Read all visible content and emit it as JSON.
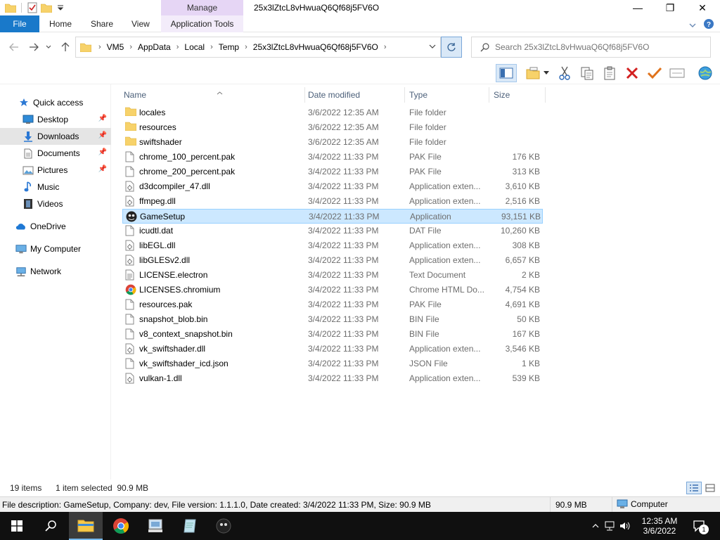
{
  "titlebar": {
    "manage_label": "Manage",
    "window_title": "25x3lZtcL8vHwuaQ6Qf68j5FV6O",
    "minimize": "—",
    "maximize": "❐",
    "close": "✕"
  },
  "ribbon": {
    "file": "File",
    "home": "Home",
    "share": "Share",
    "view": "View",
    "app_tools": "Application Tools"
  },
  "address": {
    "crumbs": [
      "VM5",
      "AppData",
      "Local",
      "Temp",
      "25x3lZtcL8vHwuaQ6Qf68j5FV6O"
    ]
  },
  "search": {
    "placeholder": "Search 25x3lZtcL8vHwuaQ6Qf68j5FV6O"
  },
  "navpane": {
    "quick_access": "Quick access",
    "desktop": "Desktop",
    "downloads": "Downloads",
    "documents": "Documents",
    "pictures": "Pictures",
    "music": "Music",
    "videos": "Videos",
    "onedrive": "OneDrive",
    "my_computer": "My Computer",
    "network": "Network"
  },
  "columns": {
    "name": "Name",
    "date": "Date modified",
    "type": "Type",
    "size": "Size"
  },
  "files": [
    {
      "name": "locales",
      "date": "3/6/2022 12:35 AM",
      "type": "File folder",
      "size": "",
      "icon": "folder"
    },
    {
      "name": "resources",
      "date": "3/6/2022 12:35 AM",
      "type": "File folder",
      "size": "",
      "icon": "folder"
    },
    {
      "name": "swiftshader",
      "date": "3/6/2022 12:35 AM",
      "type": "File folder",
      "size": "",
      "icon": "folder"
    },
    {
      "name": "chrome_100_percent.pak",
      "date": "3/4/2022 11:33 PM",
      "type": "PAK File",
      "size": "176 KB",
      "icon": "file"
    },
    {
      "name": "chrome_200_percent.pak",
      "date": "3/4/2022 11:33 PM",
      "type": "PAK File",
      "size": "313 KB",
      "icon": "file"
    },
    {
      "name": "d3dcompiler_47.dll",
      "date": "3/4/2022 11:33 PM",
      "type": "Application exten...",
      "size": "3,610 KB",
      "icon": "dll"
    },
    {
      "name": "ffmpeg.dll",
      "date": "3/4/2022 11:33 PM",
      "type": "Application exten...",
      "size": "2,516 KB",
      "icon": "dll"
    },
    {
      "name": "GameSetup",
      "date": "3/4/2022 11:33 PM",
      "type": "Application",
      "size": "93,151 KB",
      "icon": "app"
    },
    {
      "name": "icudtl.dat",
      "date": "3/4/2022 11:33 PM",
      "type": "DAT File",
      "size": "10,260 KB",
      "icon": "file"
    },
    {
      "name": "libEGL.dll",
      "date": "3/4/2022 11:33 PM",
      "type": "Application exten...",
      "size": "308 KB",
      "icon": "dll"
    },
    {
      "name": "libGLESv2.dll",
      "date": "3/4/2022 11:33 PM",
      "type": "Application exten...",
      "size": "6,657 KB",
      "icon": "dll"
    },
    {
      "name": "LICENSE.electron",
      "date": "3/4/2022 11:33 PM",
      "type": "Text Document",
      "size": "2 KB",
      "icon": "text"
    },
    {
      "name": "LICENSES.chromium",
      "date": "3/4/2022 11:33 PM",
      "type": "Chrome HTML Do...",
      "size": "4,754 KB",
      "icon": "chrome"
    },
    {
      "name": "resources.pak",
      "date": "3/4/2022 11:33 PM",
      "type": "PAK File",
      "size": "4,691 KB",
      "icon": "file"
    },
    {
      "name": "snapshot_blob.bin",
      "date": "3/4/2022 11:33 PM",
      "type": "BIN File",
      "size": "50 KB",
      "icon": "file"
    },
    {
      "name": "v8_context_snapshot.bin",
      "date": "3/4/2022 11:33 PM",
      "type": "BIN File",
      "size": "167 KB",
      "icon": "file"
    },
    {
      "name": "vk_swiftshader.dll",
      "date": "3/4/2022 11:33 PM",
      "type": "Application exten...",
      "size": "3,546 KB",
      "icon": "dll"
    },
    {
      "name": "vk_swiftshader_icd.json",
      "date": "3/4/2022 11:33 PM",
      "type": "JSON File",
      "size": "1 KB",
      "icon": "file"
    },
    {
      "name": "vulkan-1.dll",
      "date": "3/4/2022 11:33 PM",
      "type": "Application exten...",
      "size": "539 KB",
      "icon": "dll"
    }
  ],
  "selected_index": 7,
  "status": {
    "count": "19 items",
    "selected": "1 item selected  90.9 MB"
  },
  "infobar": {
    "description": "File description: GameSetup, Company: dev, File version: 1.1.1.0, Date created: 3/4/2022 11:33 PM, Size: 90.9 MB",
    "size": "90.9 MB",
    "location": "Computer"
  },
  "taskbar": {
    "time": "12:35 AM",
    "date": "3/6/2022",
    "notification_count": "1"
  },
  "colors": {
    "accent": "#1979ca",
    "selection": "#cce8ff",
    "manage_tab": "#e6d6f5"
  }
}
